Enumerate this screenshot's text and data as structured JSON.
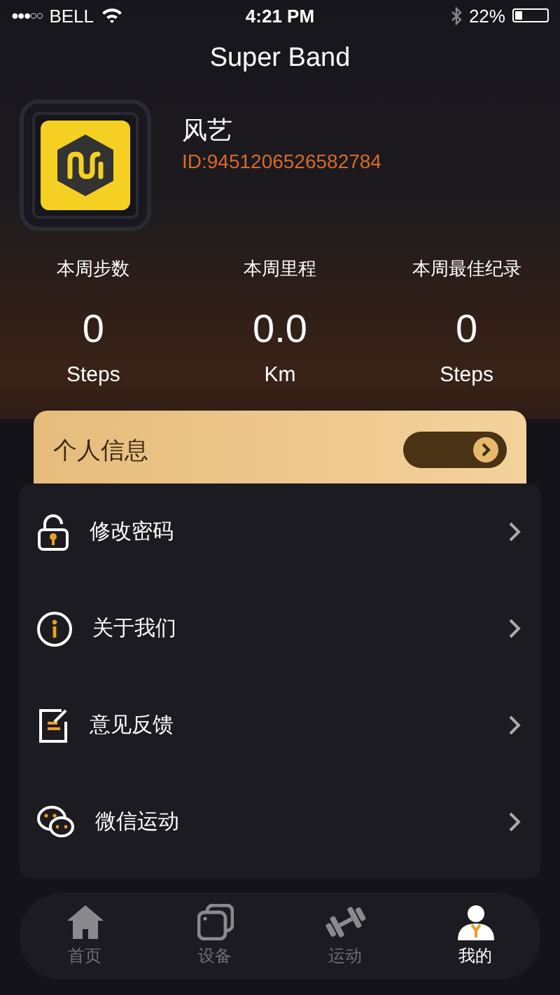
{
  "status_bar": {
    "carrier": "BELL",
    "signal_dots": "●●●○○",
    "time": "4:21 PM",
    "battery_text": "22%",
    "battery": {
      "level": 0.22
    }
  },
  "title": "Super Band",
  "profile": {
    "name": "风艺",
    "id": "ID:9451206526582784"
  },
  "stats": [
    {
      "label": "本周步数",
      "value": "0",
      "unit": "Steps"
    },
    {
      "label": "本周里程",
      "value": "0.0",
      "unit": "Km"
    },
    {
      "label": "本周最佳纪录",
      "value": "0",
      "unit": "Steps"
    }
  ],
  "info_card": {
    "label": "个人信息"
  },
  "menu": [
    {
      "kind": "lock",
      "label": "修改密码"
    },
    {
      "kind": "info",
      "label": "关于我们"
    },
    {
      "kind": "feedback",
      "label": "意见反馈"
    },
    {
      "kind": "wechat",
      "label": "微信运动"
    }
  ],
  "tabs": [
    {
      "kind": "home",
      "label": "首页",
      "selected": false
    },
    {
      "kind": "device",
      "label": "设备",
      "selected": false
    },
    {
      "kind": "sport",
      "label": "运动",
      "selected": false
    },
    {
      "kind": "me",
      "label": "我的",
      "selected": true
    }
  ]
}
